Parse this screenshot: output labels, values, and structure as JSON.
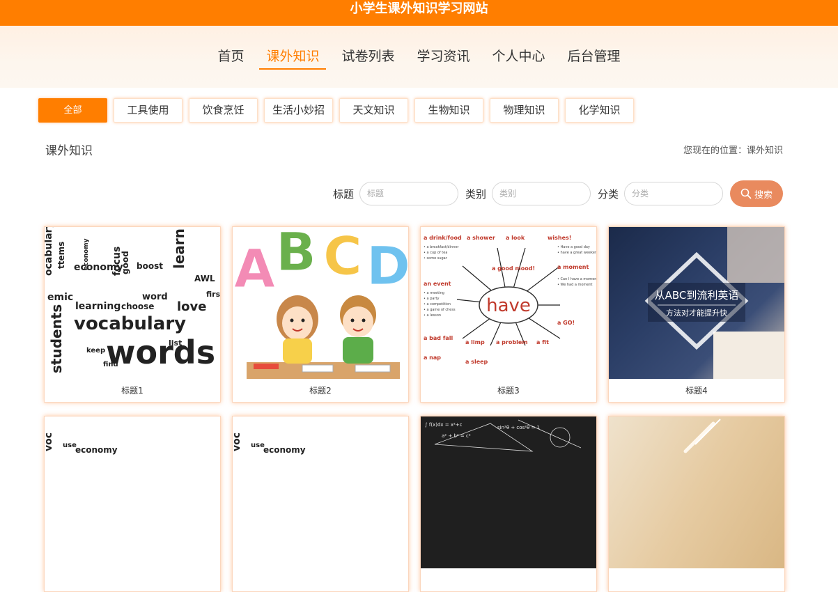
{
  "site": {
    "title": "小学生课外知识学习网站"
  },
  "nav": {
    "items": [
      {
        "label": "首页",
        "active": false
      },
      {
        "label": "课外知识",
        "active": true
      },
      {
        "label": "试卷列表",
        "active": false
      },
      {
        "label": "学习资讯",
        "active": false
      },
      {
        "label": "个人中心",
        "active": false
      },
      {
        "label": "后台管理",
        "active": false
      }
    ]
  },
  "categories": [
    {
      "label": "全部",
      "active": true
    },
    {
      "label": "工具使用",
      "active": false
    },
    {
      "label": "饮食烹饪",
      "active": false
    },
    {
      "label": "生活小妙招",
      "active": false
    },
    {
      "label": "天文知识",
      "active": false
    },
    {
      "label": "生物知识",
      "active": false
    },
    {
      "label": "物理知识",
      "active": false
    },
    {
      "label": "化学知识",
      "active": false
    }
  ],
  "section": {
    "title": "课外知识",
    "breadcrumb": "您现在的位置：课外知识"
  },
  "search": {
    "title_label": "标题",
    "title_placeholder": "标题",
    "type_label": "类别",
    "type_placeholder": "类别",
    "category_label": "分类",
    "category_placeholder": "分类",
    "button_label": "搜索"
  },
  "cards": [
    {
      "caption": "标题1"
    },
    {
      "caption": "标题2"
    },
    {
      "caption": "标题3"
    },
    {
      "caption": "标题4"
    },
    {
      "caption": ""
    },
    {
      "caption": ""
    },
    {
      "caption": ""
    },
    {
      "caption": ""
    }
  ],
  "thumbs": {
    "abc_letters": [
      "A",
      "B",
      "C",
      "D"
    ],
    "have_center": "have",
    "english_line1": "从ABC到流利英语",
    "english_line2": "方法对才能提升快",
    "words_big": "words",
    "words_vocab": "vocabulary",
    "words_learning": "learning",
    "words_economy": "economy",
    "words_students": "students"
  },
  "colors": {
    "brand": "#ff7e00",
    "search_button": "#e98a5e"
  }
}
